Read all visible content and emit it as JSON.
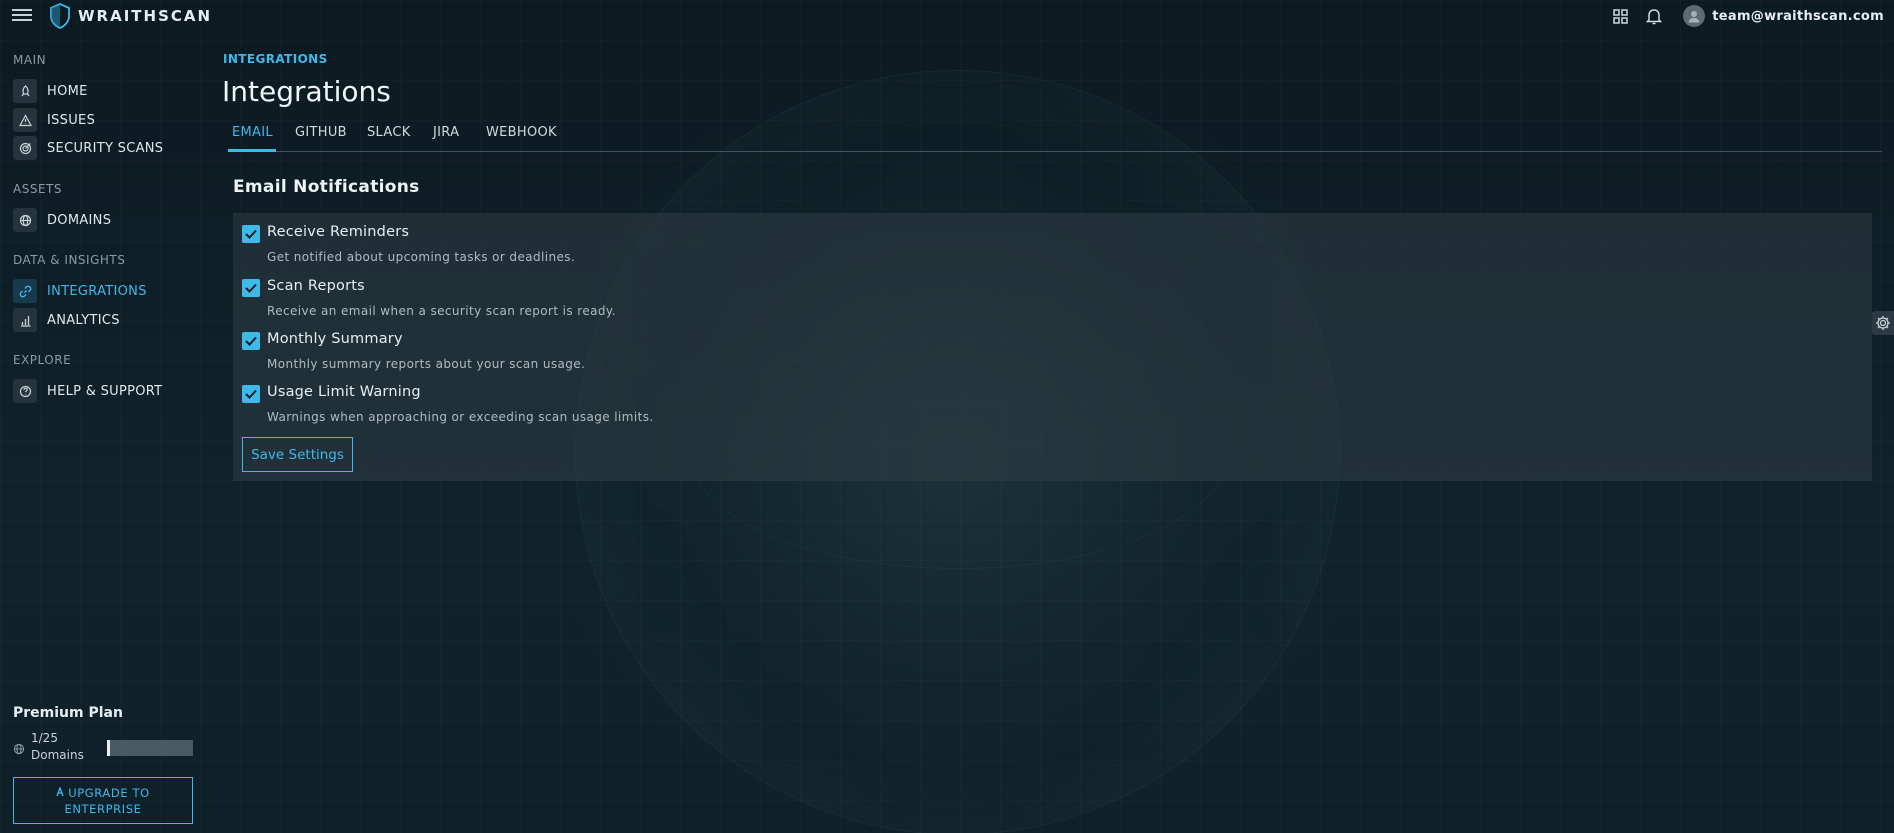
{
  "app": {
    "name": "WRAITHSCAN"
  },
  "user": {
    "email": "team@wraithscan.com"
  },
  "sidebar": {
    "sections": [
      {
        "label": "MAIN"
      },
      {
        "label": "ASSETS"
      },
      {
        "label": "DATA & INSIGHTS"
      },
      {
        "label": "EXPLORE"
      }
    ],
    "items": [
      {
        "label": "HOME",
        "icon": "rocket-icon"
      },
      {
        "label": "ISSUES",
        "icon": "warning-icon"
      },
      {
        "label": "SECURITY SCANS",
        "icon": "target-icon"
      },
      {
        "label": "DOMAINS",
        "icon": "globe-icon"
      },
      {
        "label": "INTEGRATIONS",
        "icon": "link-icon",
        "active": true
      },
      {
        "label": "ANALYTICS",
        "icon": "bar-chart-icon"
      },
      {
        "label": "HELP & SUPPORT",
        "icon": "help-icon"
      }
    ],
    "plan": {
      "title": "Premium Plan",
      "usage_count": "1/25",
      "usage_unit": "Domains",
      "used": 1,
      "limit": 25
    },
    "upgrade": {
      "line1": "UPGRADE TO",
      "line2": "ENTERPRISE"
    }
  },
  "main": {
    "breadcrumb": "INTEGRATIONS",
    "title": "Integrations",
    "tabs": [
      {
        "label": "EMAIL",
        "active": true
      },
      {
        "label": "GITHUB"
      },
      {
        "label": "SLACK"
      },
      {
        "label": "JIRA"
      },
      {
        "label": "WEBHOOK"
      }
    ],
    "email": {
      "heading": "Email Notifications",
      "options": [
        {
          "title": "Receive Reminders",
          "desc": "Get notified about upcoming tasks or deadlines.",
          "checked": true
        },
        {
          "title": "Scan Reports",
          "desc": "Receive an email when a security scan report is ready.",
          "checked": true
        },
        {
          "title": "Monthly Summary",
          "desc": "Monthly summary reports about your scan usage.",
          "checked": true
        },
        {
          "title": "Usage Limit Warning",
          "desc": "Warnings when approaching or exceeding scan usage limits.",
          "checked": true
        }
      ],
      "save_label": "Save Settings"
    }
  },
  "colors": {
    "accent": "#3fb8ea",
    "panel": "#303e46",
    "background": "#0f1e26"
  }
}
